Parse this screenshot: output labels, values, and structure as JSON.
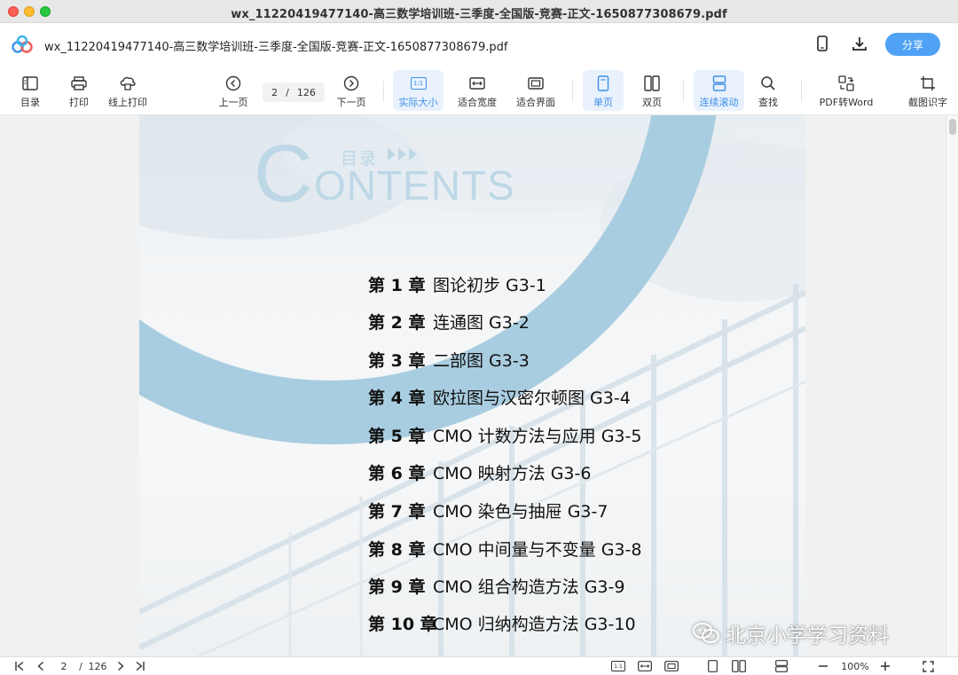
{
  "window": {
    "title": "wx_11220419477140-高三数学培训班-三季度-全国版-竞赛-正文-1650877308679.pdf"
  },
  "header": {
    "doc_title": "wx_11220419477140-高三数学培训班-三季度-全国版-竞赛-正文-1650877308679.pdf",
    "share_label": "分享",
    "icons": [
      "phone-icon",
      "download-icon"
    ]
  },
  "toolbar": {
    "toc": "目录",
    "print": "打印",
    "online_print": "线上打印",
    "prev_page": "上一页",
    "next_page": "下一页",
    "current_page": "2",
    "page_sep": "/",
    "total_pages": "126",
    "actual_size": "实际大小",
    "fit_width": "适合宽度",
    "fit_page": "适合界面",
    "single_page": "单页",
    "double_page": "双页",
    "continuous_scroll": "连续滚动",
    "search": "查找",
    "pdf_to_word": "PDF转Word",
    "ocr": "截图识字",
    "actual_size_icon_text": "1:1"
  },
  "document": {
    "mulu": "目录",
    "contents_c": "C",
    "contents_rest": "ONTENTS",
    "toc_items": [
      {
        "chapter": "第 1 章",
        "title": "图论初步 G3-1"
      },
      {
        "chapter": "第 2 章",
        "title": "连通图 G3-2"
      },
      {
        "chapter": "第 3 章",
        "title": "二部图 G3-3"
      },
      {
        "chapter": "第 4 章",
        "title": "欧拉图与汉密尔顿图 G3-4"
      },
      {
        "chapter": "第 5 章",
        "title": "CMO 计数方法与应用 G3-5"
      },
      {
        "chapter": "第 6 章",
        "title": "CMO 映射方法 G3-6"
      },
      {
        "chapter": "第 7 章",
        "title": "CMO 染色与抽屉 G3-7"
      },
      {
        "chapter": "第 8 章",
        "title": "CMO 中间量与不变量 G3-8"
      },
      {
        "chapter": "第 9 章",
        "title": "CMO 组合构造方法 G3-9"
      },
      {
        "chapter": "第 10 章",
        "title": "CMO 归纳构造方法 G3-10"
      }
    ],
    "accent_color": "#a9cde0"
  },
  "watermark": {
    "text": "北京小学学习资料"
  },
  "statusbar": {
    "current_page": "2",
    "page_sep": "/",
    "total_pages": "126",
    "zoom": "100%",
    "actual_size_icon_text": "1:1"
  },
  "colors": {
    "accent": "#4fa2f5",
    "active_bg": "#e8f1fc"
  }
}
